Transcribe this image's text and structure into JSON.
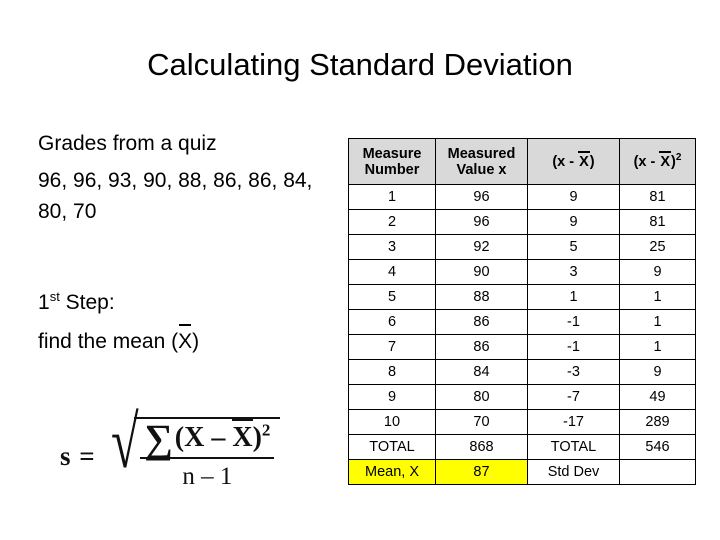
{
  "slide": {
    "title": "Calculating Standard Deviation"
  },
  "left": {
    "grades_heading": "Grades from a quiz",
    "grades_values": "96,  96, 93, 90, 88, 86, 86, 84, 80, 70",
    "step_number": "1",
    "step_ordinal": "st",
    "step_label_rest": " Step:",
    "step_text_prefix": "find the mean (",
    "step_text_symbol": "X",
    "step_text_suffix": ")"
  },
  "formula": {
    "lhs": "s =",
    "sigma": "∑",
    "numerator_open": "(X – ",
    "numerator_symbol": "X",
    "numerator_close": ")",
    "numerator_exponent": "2",
    "denominator": "n – 1",
    "radical_sign": "√"
  },
  "table": {
    "headers": [
      {
        "line1": "Measure",
        "line2": "Number"
      },
      {
        "line1": "Measured",
        "line2": "Value x"
      },
      {
        "prefix": "(x - ",
        "symbol": "X",
        "suffix": ")",
        "exponent": ""
      },
      {
        "prefix": "(x - ",
        "symbol": "X",
        "suffix": ")",
        "exponent": "2"
      }
    ],
    "rows": [
      {
        "number": "1",
        "value": "96",
        "dev": "9",
        "devsq": "81"
      },
      {
        "number": "2",
        "value": "96",
        "dev": "9",
        "devsq": "81"
      },
      {
        "number": "3",
        "value": "92",
        "dev": "5",
        "devsq": "25"
      },
      {
        "number": "4",
        "value": "90",
        "dev": "3",
        "devsq": "9"
      },
      {
        "number": "5",
        "value": "88",
        "dev": "1",
        "devsq": "1"
      },
      {
        "number": "6",
        "value": "86",
        "dev": "-1",
        "devsq": "1"
      },
      {
        "number": "7",
        "value": "86",
        "dev": "-1",
        "devsq": "1"
      },
      {
        "number": "8",
        "value": "84",
        "dev": "-3",
        "devsq": "9"
      },
      {
        "number": "9",
        "value": "80",
        "dev": "-7",
        "devsq": "49"
      },
      {
        "number": "10",
        "value": "70",
        "dev": "-17",
        "devsq": "289"
      }
    ],
    "total_row": {
      "number": "TOTAL",
      "value": "868",
      "dev": "TOTAL",
      "devsq": "546"
    },
    "mean_row": {
      "number": "Mean, X",
      "value": "87",
      "dev": "Std Dev",
      "devsq": ""
    }
  },
  "colors": {
    "header_fill": "#d9d9d9",
    "highlight": "#ffff00",
    "border": "#000000",
    "text": "#000000",
    "background": "#ffffff"
  }
}
